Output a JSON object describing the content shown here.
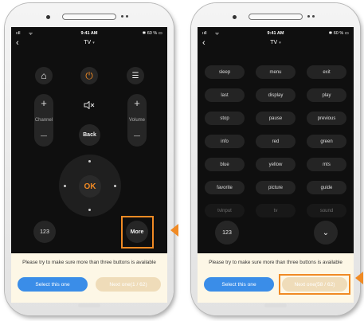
{
  "left_phone": {
    "status": {
      "signal": "ııll",
      "wifi": "ᯤ",
      "time": "9:41 AM",
      "battery": "✱ 60 % ▭"
    },
    "nav": {
      "back": "‹",
      "title": "TV",
      "title_suffix": "▾"
    },
    "remote": {
      "home_icon": "⌂",
      "power_icon": "⏻",
      "menu_icon": "☰",
      "plus": "+",
      "minus": "—",
      "mute_icon": "🔇",
      "channel_label": "Channel",
      "volume_label": "Volume",
      "back_label": "Back",
      "ok_label": "OK",
      "numpad_label": "123",
      "more_label": "More"
    },
    "panel": {
      "hint": "Please try to make sure more than three buttons is available",
      "select_label": "Select this one",
      "next_label": "Next one(1 / 62)"
    }
  },
  "right_phone": {
    "status": {
      "signal": "ııll",
      "wifi": "ᯤ",
      "time": "9:41 AM",
      "battery": "✱ 60 % ▭"
    },
    "nav": {
      "back": "‹",
      "title": "TV",
      "title_suffix": "▾"
    },
    "grid": [
      [
        "sleep",
        "menu",
        "exit"
      ],
      [
        "last",
        "display",
        "play"
      ],
      [
        "stop",
        "pause",
        "previous"
      ],
      [
        "info",
        "red",
        "green"
      ],
      [
        "blue",
        "yellow",
        "mts"
      ],
      [
        "favorite",
        "picture",
        "guide"
      ],
      [
        "tvinput",
        "tv",
        "sound"
      ]
    ],
    "numpad_label": "123",
    "chevron": "⌄",
    "panel": {
      "hint": "Please try to make sure more than three buttons is available",
      "select_label": "Select this one",
      "next_label": "Next one(58 / 62)"
    }
  },
  "colors": {
    "accent_orange": "#f08a24",
    "select_blue": "#3a8de8",
    "next_beige": "#efdcb9",
    "screen_bg": "#0f0f0f"
  }
}
